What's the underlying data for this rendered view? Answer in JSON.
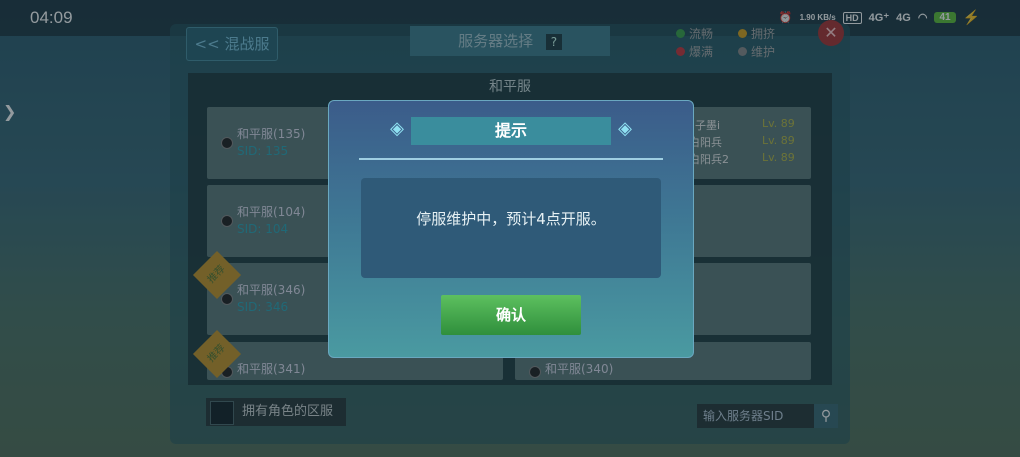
{
  "status_bar": {
    "time": "04:09",
    "speed": "1.90\nKB/s",
    "hd": "HD",
    "net1": "4G⁺",
    "net2": "4G",
    "battery": "41"
  },
  "header": {
    "back_label": "<< 混战服",
    "title": "服务器选择",
    "help": "?"
  },
  "legend": [
    {
      "label": "流畅",
      "color": "#3ba34a"
    },
    {
      "label": "拥挤",
      "color": "#d7a21e"
    },
    {
      "label": "爆满",
      "color": "#c8353d"
    },
    {
      "label": "维护",
      "color": "#8a8a8a"
    }
  ],
  "server_group_title": "和平服",
  "servers": [
    {
      "name": "和平服(135)",
      "sid": "SID: 135"
    },
    {
      "name": "和平服(104)",
      "sid": "SID: 104"
    },
    {
      "name": "和平服(346)",
      "sid": "SID: 346"
    },
    {
      "name": "和平服(341)"
    },
    {
      "name": "和平服(340)"
    }
  ],
  "badges": [
    "推荐",
    "推荐"
  ],
  "roles": [
    {
      "name": "子墨i",
      "level": "Lv. 89"
    },
    {
      "name": "白阳兵",
      "level": "Lv. 89"
    },
    {
      "name": "白阳兵2",
      "level": "Lv. 89"
    }
  ],
  "footer": {
    "checkbox_label": "拥有角色的区服",
    "search_placeholder": "输入服务器SID"
  },
  "dialog": {
    "title": "提示",
    "message": "停服维护中，预计4点开服。",
    "confirm": "确认"
  }
}
